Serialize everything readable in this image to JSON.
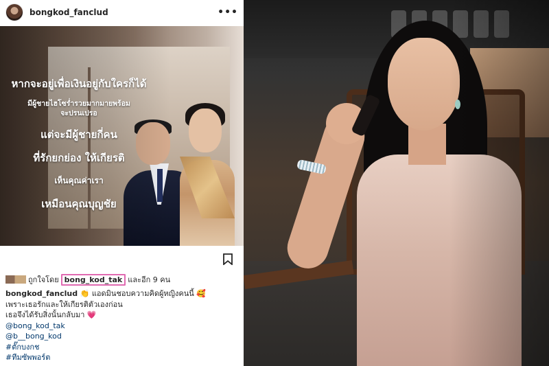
{
  "post": {
    "username": "bongkod_fanclud",
    "more_icon": "more-dots-icon",
    "image_text": {
      "line1": "หากจะอยู่เพื่อเงินอยู่กับใครก็ได้",
      "line2": "มีผู้ชายไฮโซร่ำรวยมากมายพร้อม",
      "line3": "จะปรนเปรอ",
      "line4": "แต่จะมีผู้ชายกี่คน",
      "line5": "ที่รักยกย่อง ให้เกียรติ",
      "line6": "เห็นคุณค่าเรา",
      "line7": "เหมือนคุณบุญชัย"
    },
    "likes": {
      "prefix": "ถูกใจโดย",
      "user": "bong_kod_tak",
      "suffix": "และอีก 9 คน"
    },
    "caption": {
      "user": "bongkod_fanclud",
      "text1": "แอดมินชอบความคิดผู้หญิงคนนี้",
      "text2": "เพราะเธอรักและให้เกียรติตัวเองก่อน",
      "text3": "เธอจึงได้รับสิ่งนั้นกลับมา",
      "emoji_clap": "👏",
      "emoji_love": "🥰",
      "emoji_heart": "💗",
      "tags": [
        "@bong_kod_tak",
        "@b__bong_kod",
        "#ตั๊กบงกช",
        "#ทีมซัพพอร์ต"
      ]
    },
    "icons": {
      "bookmark": "bookmark-icon"
    }
  },
  "colors": {
    "highlight_border": "#e06ab1",
    "link": "#00376b",
    "text": "#262626"
  }
}
